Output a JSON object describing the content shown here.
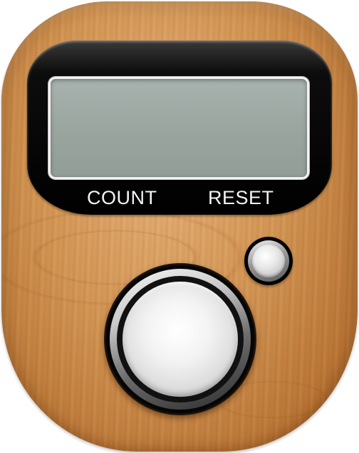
{
  "labels": {
    "count": "COUNT",
    "reset": "RESET"
  },
  "screen": {
    "display": ""
  },
  "colors": {
    "wood": "#d29553",
    "bezel": "#000000",
    "lcd": "#9aa49f",
    "label_text": "#f4f4f4",
    "button_cap": "#e8e8e8"
  },
  "icons": {
    "count_button": "large-round-chrome-button",
    "reset_button": "small-round-chrome-button"
  }
}
